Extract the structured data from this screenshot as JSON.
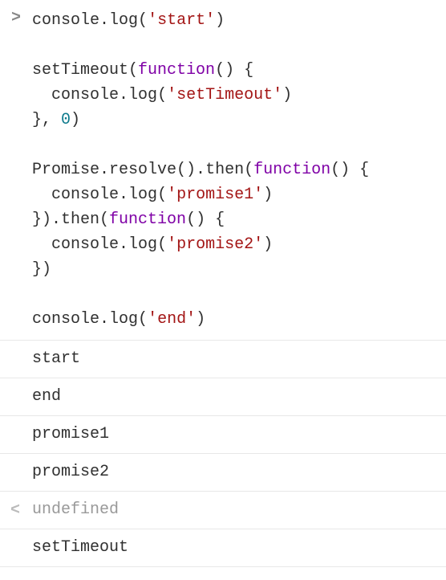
{
  "console": {
    "input_prompt": ">",
    "return_prompt": "<",
    "code": {
      "l1": {
        "obj": "console",
        "dot": ".",
        "method": "log",
        "open": "(",
        "str": "'start'",
        "close": ")"
      },
      "l3a": {
        "func": "setTimeout",
        "open": "(",
        "kw": "function",
        "paren": "() {"
      },
      "l4": {
        "indent": "  ",
        "obj": "console",
        "dot": ".",
        "method": "log",
        "open": "(",
        "str": "'setTimeout'",
        "close": ")"
      },
      "l5": {
        "close": "}, ",
        "num": "0",
        "end": ")"
      },
      "l7a": {
        "obj": "Promise",
        "dot1": ".",
        "m1": "resolve",
        "p1": "().",
        "m2": "then",
        "open": "(",
        "kw": "function",
        "paren": "() {"
      },
      "l8": {
        "indent": "  ",
        "obj": "console",
        "dot": ".",
        "method": "log",
        "open": "(",
        "str": "'promise1'",
        "close": ")"
      },
      "l9a": {
        "close": "}).",
        "m": "then",
        "open": "(",
        "kw": "function",
        "paren": "() {"
      },
      "l10": {
        "indent": "  ",
        "obj": "console",
        "dot": ".",
        "method": "log",
        "open": "(",
        "str": "'promise2'",
        "close": ")"
      },
      "l11": {
        "close": "})"
      },
      "l13": {
        "obj": "console",
        "dot": ".",
        "method": "log",
        "open": "(",
        "str": "'end'",
        "close": ")"
      }
    },
    "outputs": [
      "start",
      "end",
      "promise1",
      "promise2"
    ],
    "return_value": "undefined",
    "outputs_after": [
      "setTimeout"
    ]
  }
}
